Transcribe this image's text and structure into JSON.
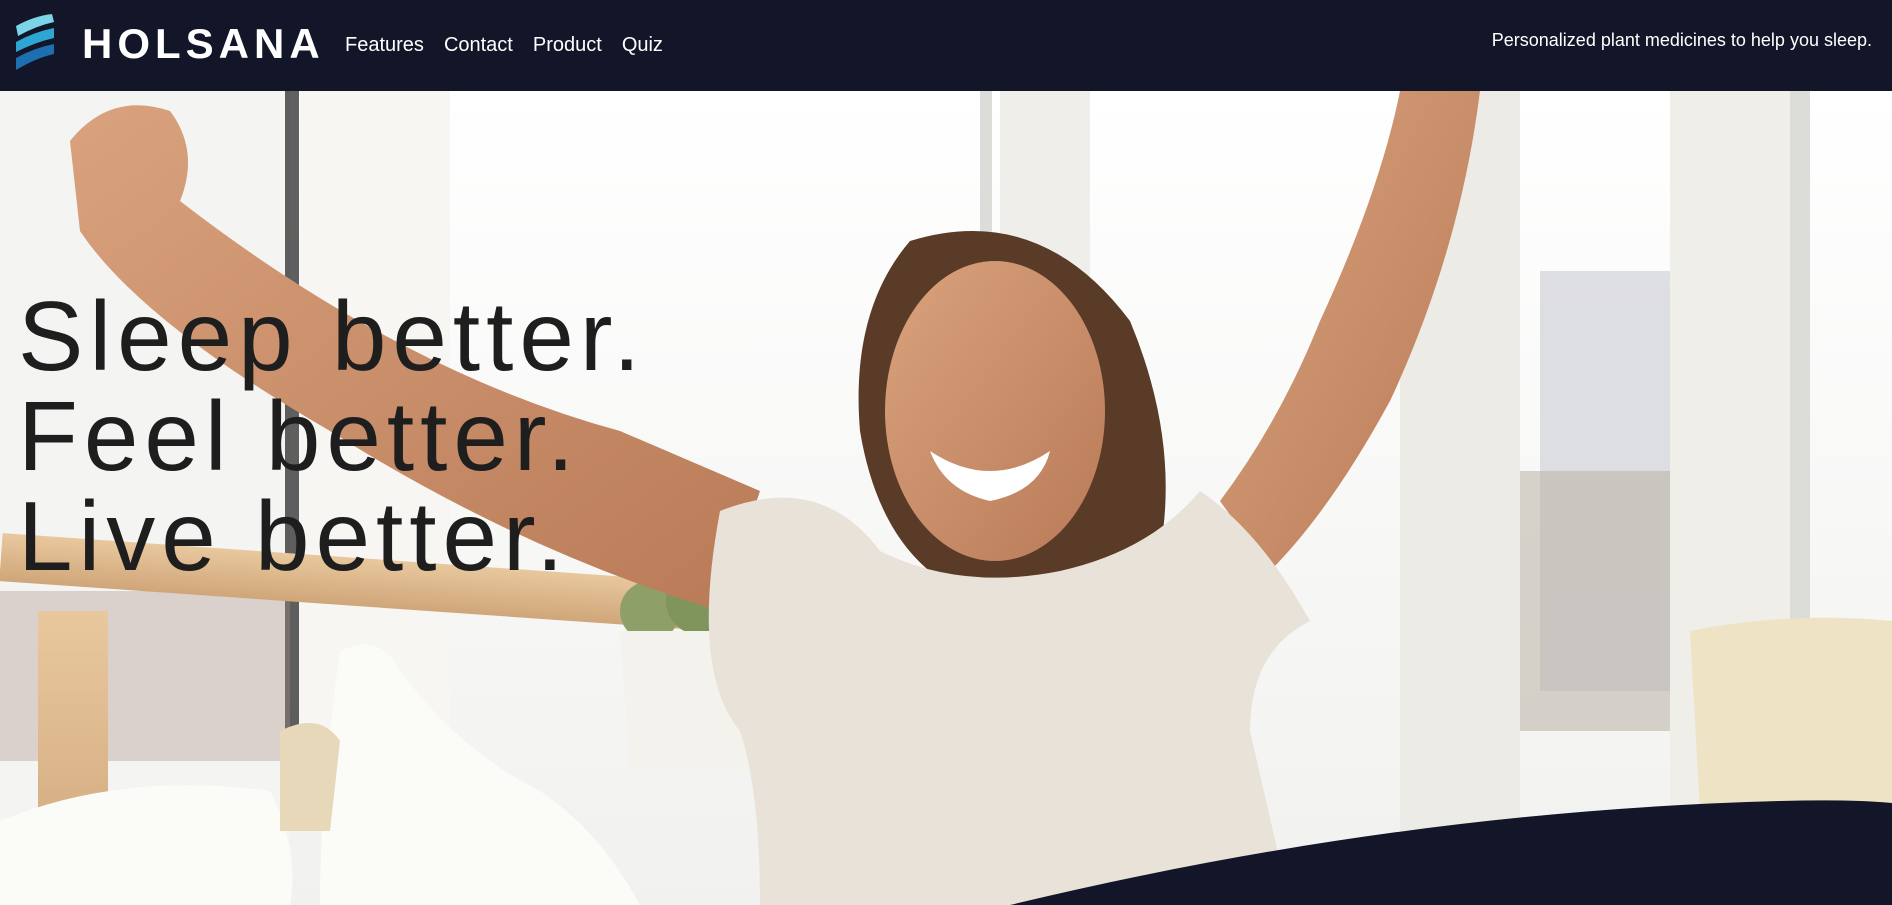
{
  "brand": {
    "name": "HOLSANA",
    "logo_icon": "wave-stripes-icon",
    "logo_colors": [
      "#7dd3e8",
      "#2ea6d4",
      "#1e6fb0"
    ]
  },
  "nav": {
    "items": [
      {
        "label": "Features"
      },
      {
        "label": "Contact"
      },
      {
        "label": "Product"
      },
      {
        "label": "Quiz"
      }
    ]
  },
  "header": {
    "tagline": "Personalized plant medicines to help you sleep."
  },
  "hero": {
    "headline": [
      "Sleep better.",
      "Feel better.",
      "Live better."
    ],
    "image_subject": "woman stretching in bed by window"
  },
  "colors": {
    "navbar_bg": "#121628",
    "headline_text": "#1e1e1e",
    "wave_bg": "#121628"
  }
}
